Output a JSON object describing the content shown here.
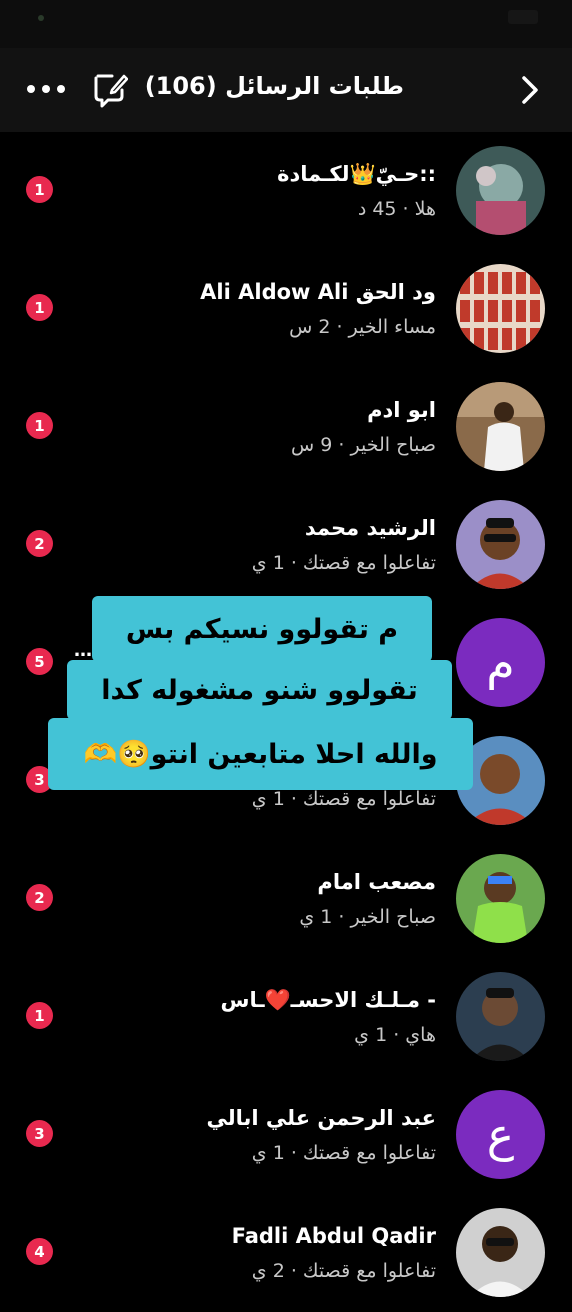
{
  "header": {
    "title": "طلبات الرسائل",
    "count": "(106)"
  },
  "colors": {
    "badge": "#e8294f",
    "overlay": "#43c3d6",
    "letter_avatar": "#7b2bbf"
  },
  "rows": [
    {
      "name": "::حـيّ👑لكـمادة",
      "sub": "هلا · 45 د",
      "badge": "1"
    },
    {
      "name": "ود الحق Ali Aldow Ali",
      "sub": "مساء الخير · 2 س",
      "badge": "1"
    },
    {
      "name": "ابو ادم",
      "sub": "صباح الخير · 9 س",
      "badge": "1"
    },
    {
      "name": "الرشيد محمد",
      "sub": "تفاعلوا مع قصتك · 1 ي",
      "badge": "2"
    },
    {
      "name": "",
      "sub": "",
      "badge": "5",
      "avatar_letter": "م"
    },
    {
      "name": "",
      "sub": "تفاعلوا مع قصتك · 1 ي",
      "badge": "3"
    },
    {
      "name": "مصعب امام",
      "sub": "صباح الخير · 1 ي",
      "badge": "2"
    },
    {
      "name": "- مـلـك الاحسـ❤️ـاس",
      "sub": "هاي · 1 ي",
      "badge": "1"
    },
    {
      "name": "عبد الرحمن علي ابالي",
      "sub": "تفاعلوا مع قصتك · 1 ي",
      "badge": "3",
      "avatar_letter": "ع"
    },
    {
      "name": "Fadli Abdul Qadir",
      "sub": "تفاعلوا مع قصتك · 2 ي",
      "badge": "4"
    }
  ],
  "overlay_text": {
    "line1": "م تقولوو نسيكم بس",
    "line2": "تقولوو شنو مشغوله كدا",
    "line3": "والله احلا متابعين انتو🥺🫶"
  },
  "icons": {
    "back": "chevron-right-icon",
    "compose": "compose-chat-icon",
    "more": "more-dots-icon"
  }
}
